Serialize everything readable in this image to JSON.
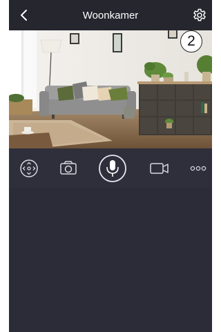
{
  "header": {
    "title": "Woonkamer",
    "back_icon": "chevron-left-icon",
    "settings_icon": "gear-icon"
  },
  "callout": {
    "number": "2"
  },
  "video": {
    "description_icon": "camera-feed"
  },
  "toolbar": {
    "items": [
      {
        "icon": "ptz-control-icon"
      },
      {
        "icon": "snapshot-camera-icon"
      },
      {
        "icon": "microphone-icon"
      },
      {
        "icon": "video-record-icon"
      },
      {
        "icon": "more-dots-icon"
      }
    ]
  },
  "colors": {
    "header_bg": "#25262e",
    "toolbar_bg": "#2e2f3b",
    "body_bg": "#2b2c38",
    "icon": "#d8d8e0"
  }
}
